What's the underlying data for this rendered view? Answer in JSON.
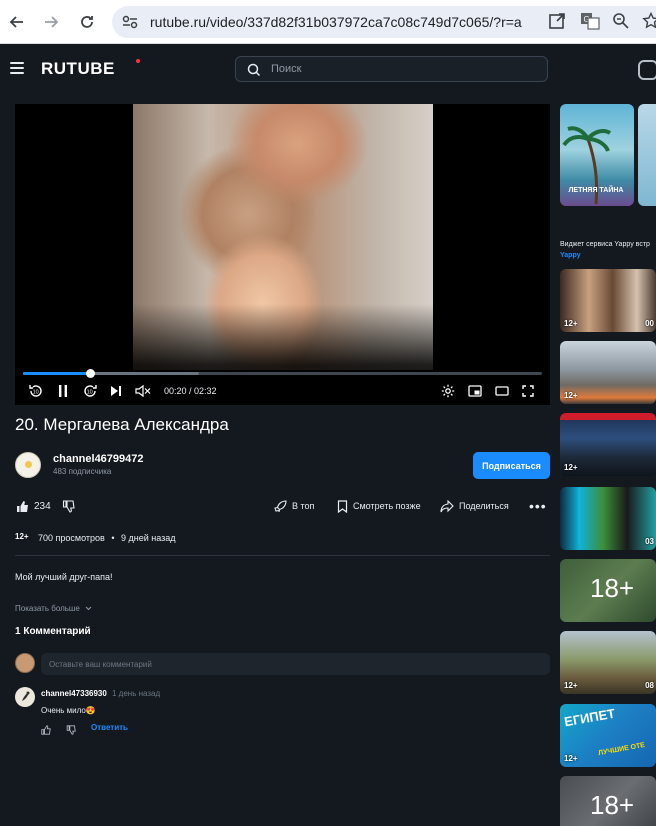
{
  "browser": {
    "url": "rutube.ru/video/337d82f31b037972ca7c08c749d7c065/?r=a"
  },
  "header": {
    "logo": "RUTUBE",
    "search_placeholder": "Поиск"
  },
  "player": {
    "time": "00:20 / 02:32",
    "progress_fraction": 0.13,
    "buffered_fraction": 0.34,
    "skip_back_label": "10",
    "skip_forward_label": "10"
  },
  "video": {
    "title": "20. Мергалева Александра",
    "channel_name": "channel46799472",
    "subscribers": "483 подписчика",
    "subscribe_label": "Подписаться",
    "likes": "234",
    "actions": {
      "top": "В топ",
      "watch_later": "Смотреть позже",
      "share": "Поделиться"
    },
    "age_rating": "12+",
    "views": "700 просмотров",
    "separator": "•",
    "published": "9 дней назад",
    "description": "Мой лучший друг-папа!",
    "show_more": "Показать больше"
  },
  "comments": {
    "title": "1 Комментарий",
    "input_placeholder": "Оставьте ваш комментарий",
    "items": [
      {
        "author": "channel47336930",
        "time": "1 день назад",
        "text": "Очень мило😍",
        "reply_label": "Ответить"
      }
    ]
  },
  "sidebar": {
    "ad": {
      "thumb_text": "ЛЕТНЯЯ ТАЙНА",
      "caption": "Виджет сервиса Yappy встр",
      "brand": "Yappy"
    },
    "items": [
      {
        "age": "12+",
        "duration": "00"
      },
      {
        "age": "12+",
        "duration": ""
      },
      {
        "age": "12+",
        "duration": ""
      },
      {
        "age": "",
        "duration": "03"
      },
      {
        "big_label": "18+"
      },
      {
        "age": "12+",
        "duration": "08"
      },
      {
        "age": "12+",
        "title_text": "ЕГИПЕТ",
        "subtitle_text": "ЛУЧШИЕ ОТЕ",
        "duration": ""
      },
      {
        "big_label": "18+"
      }
    ]
  },
  "colors": {
    "accent": "#1a8cff",
    "background": "#14191f",
    "logo_dot": "#ff2e45"
  }
}
